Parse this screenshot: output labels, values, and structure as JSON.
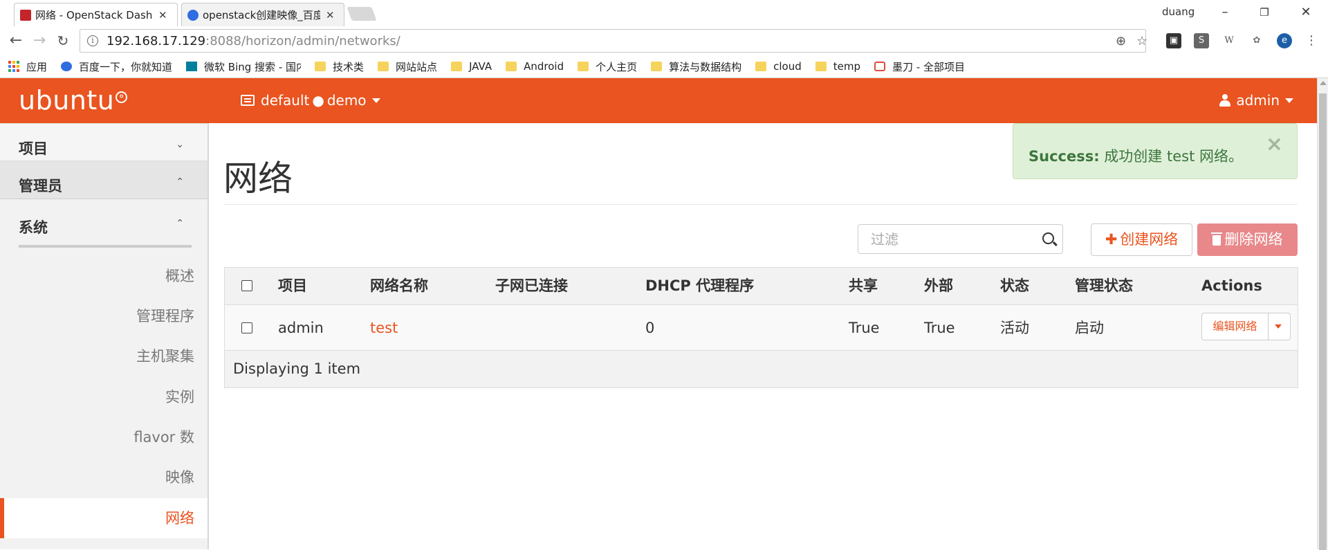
{
  "browser": {
    "tabs": [
      {
        "title": "网络 - OpenStack Dashb",
        "active": true
      },
      {
        "title": "openstack创建映像_百度",
        "active": false
      }
    ],
    "profile": "duang",
    "url_host": "192.168.17.129",
    "url_path": ":8088/horizon/admin/networks/",
    "bookmarks": [
      "应用",
      "百度一下，你就知道",
      "微软 Bing 搜索 - 国内",
      "技术类",
      "网站站点",
      "JAVA",
      "Android",
      "个人主页",
      "算法与数据结构",
      "cloud",
      "temp",
      "墨刀 - 全部项目"
    ]
  },
  "header": {
    "logo": "ubuntu",
    "project_domain": "default",
    "project_separator": "●",
    "project_name": "demo",
    "user": "admin",
    "brand_color": "#e95420"
  },
  "sidebar": {
    "sections": [
      {
        "label": "项目",
        "chevron": "⌄"
      },
      {
        "label": "管理员",
        "chevron": "⌃"
      },
      {
        "label": "系统",
        "chevron": "⌃"
      }
    ],
    "items": [
      "概述",
      "管理程序",
      "主机聚集",
      "实例",
      "flavor 数",
      "映像",
      "网络"
    ],
    "active_item": "网络"
  },
  "alert": {
    "strong": "Success:",
    "message": " 成功创建 test 网络。",
    "close": "×"
  },
  "page": {
    "title": "网络",
    "filter_placeholder": "过滤",
    "create_label": "创建网络",
    "delete_label": "删除网络"
  },
  "table": {
    "headers": [
      "项目",
      "网络名称",
      "子网已连接",
      "DHCP 代理程序",
      "共享",
      "外部",
      "状态",
      "管理状态",
      "Actions"
    ],
    "rows": [
      {
        "project": "admin",
        "name": "test",
        "subnets": "",
        "dhcp_agents": "0",
        "shared": "True",
        "external": "True",
        "status": "活动",
        "admin_state": "启动",
        "action": "编辑网络"
      }
    ],
    "footer": "Displaying 1 item"
  }
}
